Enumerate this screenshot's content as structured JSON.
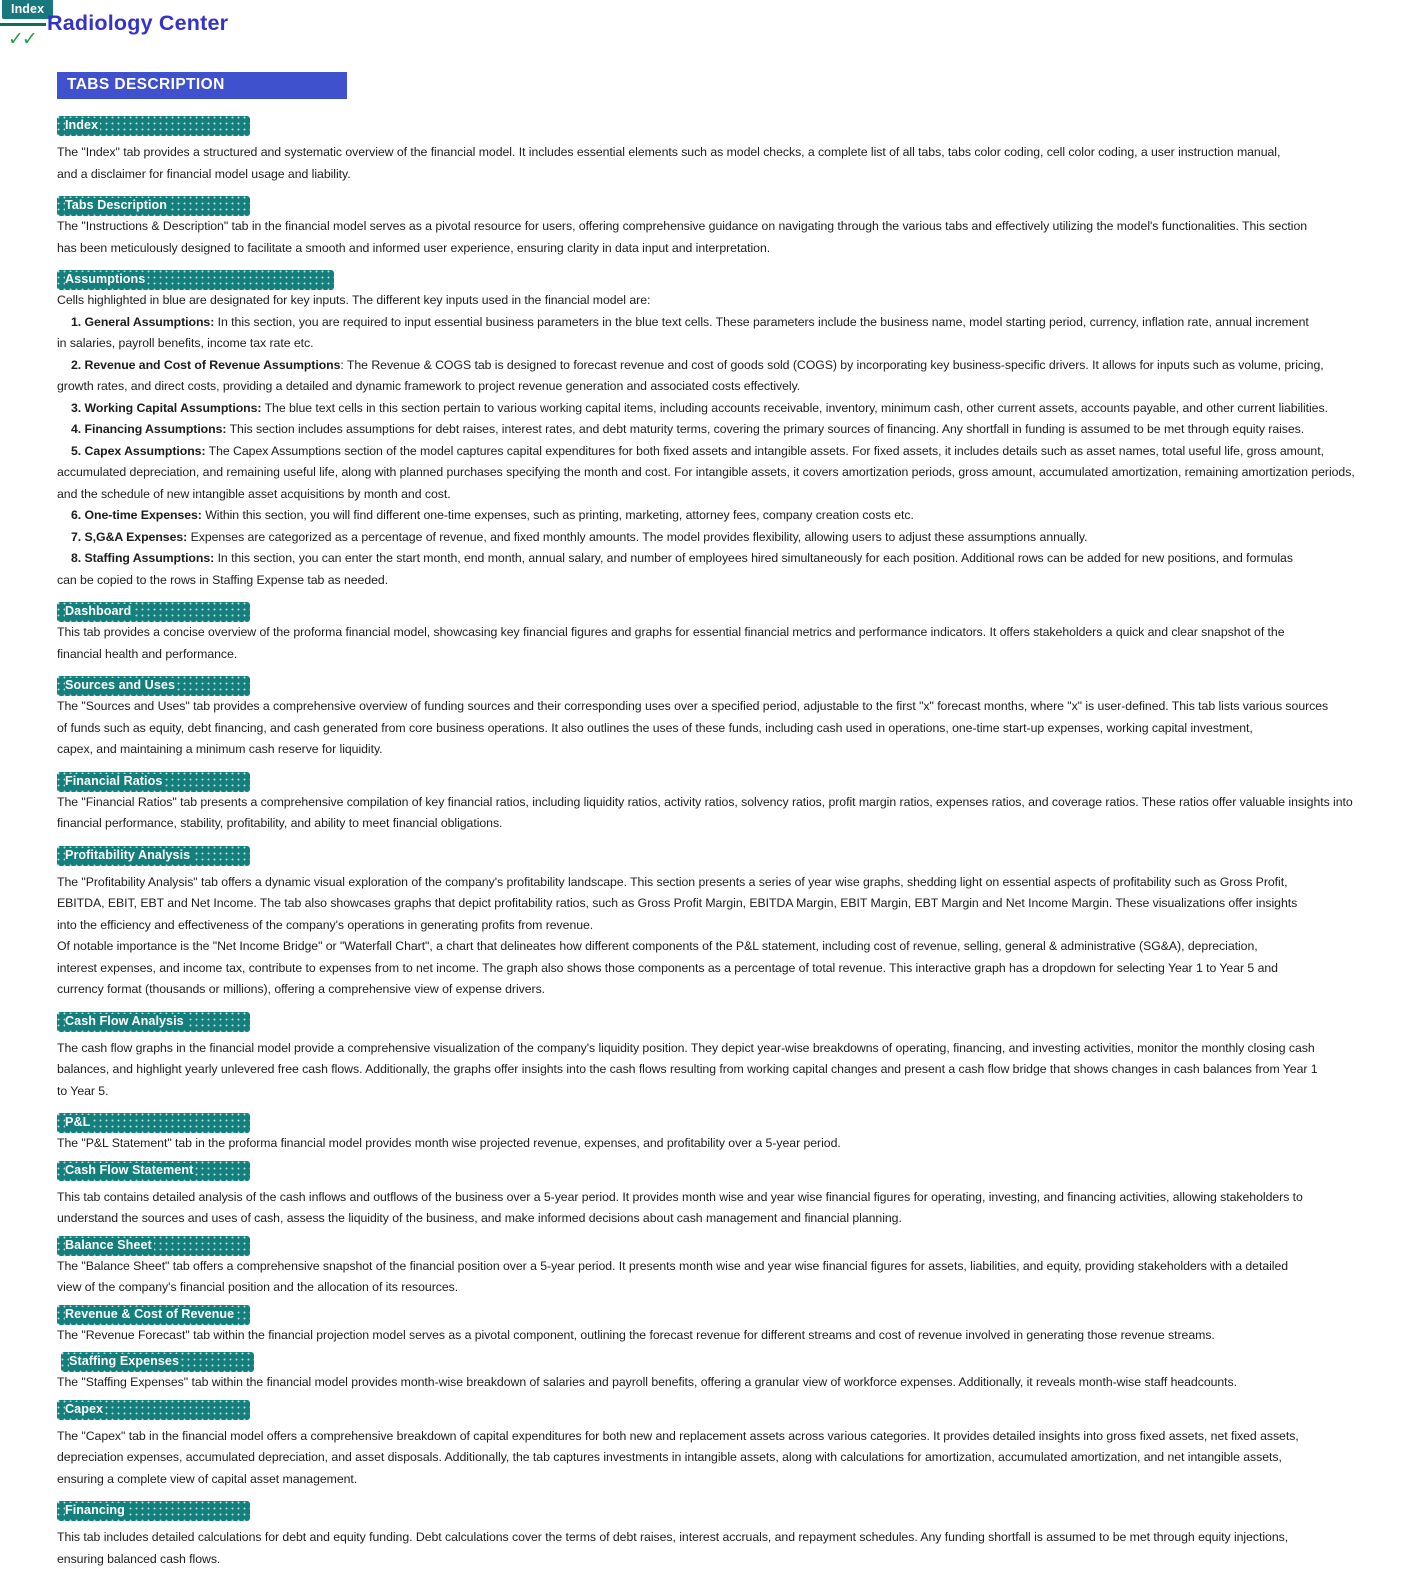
{
  "header": {
    "index_tab": "Index",
    "checkmarks": "✓✓",
    "title": "Radiology Center",
    "banner": "TABS DESCRIPTION",
    "accent_teal": "#14807d",
    "accent_blue": "#3f51cd",
    "title_color": "#3333cc",
    "check_color": "#21a04a"
  },
  "sections": {
    "index": {
      "label": "Index",
      "lines": [
        "The \"Index\" tab provides a structured and systematic overview of the financial model. It includes essential elements such as model checks, a complete list of all tabs, tabs color coding, cell color coding, a user instruction manual,",
        "and a disclaimer for financial model usage and liability."
      ]
    },
    "tabs_description": {
      "label": "Tabs Description",
      "lines": [
        "The \"Instructions & Description\" tab in the financial model serves as a pivotal resource for users, offering comprehensive guidance on navigating through the various tabs and effectively utilizing the model's functionalities. This section",
        "has been meticulously designed to facilitate a smooth and informed user experience, ensuring clarity in data input and interpretation."
      ]
    },
    "assumptions": {
      "label": "Assumptions",
      "intro": "Cells highlighted in blue are designated for key inputs. The different key inputs used in the financial model are:",
      "items": [
        {
          "num": "1. ",
          "title": "General Assumptions:",
          "rest": " In this section, you are required to input essential business parameters in the blue text cells. These parameters include the business name, model starting period, currency, inflation rate, annual increment",
          "cont": [
            "in salaries, payroll benefits, income tax rate etc."
          ]
        },
        {
          "num": "2. ",
          "title": "Revenue and Cost of Revenue Assumptions",
          "rest": ": The Revenue & COGS tab is designed to forecast revenue and cost of goods sold (COGS) by incorporating key business-specific drivers. It allows for inputs such as volume, pricing,",
          "cont": [
            "growth rates, and direct costs, providing a detailed and dynamic framework to project revenue generation and associated costs effectively."
          ]
        },
        {
          "num": "3. ",
          "title": "Working Capital Assumptions:",
          "rest": " The blue text cells in this section pertain to various working capital items, including accounts receivable, inventory, minimum cash, other current assets, accounts payable,  and other current liabilities.",
          "cont": []
        },
        {
          "num": "4. ",
          "title": "Financing Assumptions:",
          "rest": " This section includes assumptions for debt raises, interest rates, and debt maturity terms, covering the primary sources of financing. Any shortfall in funding is assumed to be met through equity raises.",
          "cont": []
        },
        {
          "num": "5. ",
          "title": "Capex Assumptions:",
          "rest": " The Capex Assumptions section of the model captures capital expenditures for both fixed assets and intangible assets. For fixed assets, it includes details such as asset names, total useful life, gross amount,",
          "cont": [
            "accumulated depreciation, and remaining useful life, along with planned purchases specifying the month and cost. For intangible assets, it covers amortization periods, gross amount, accumulated amortization, remaining amortization periods,",
            "and the schedule of new intangible asset acquisitions by month and cost."
          ]
        },
        {
          "num": "6. ",
          "title": "One-time Expenses:",
          "rest": " Within this section, you will find different one-time expenses, such as printing, marketing, attorney fees, company creation costs etc.",
          "cont": []
        },
        {
          "num": "7. ",
          "title": "S,G&A Expenses:",
          "rest": "  Expenses are categorized as a percentage  of revenue, and fixed monthly amounts. The model provides flexibility, allowing users to adjust these assumptions annually.",
          "cont": []
        },
        {
          "num": "8. ",
          "title": "Staffing Assumptions:",
          "rest": " In this section, you can enter the start month, end month, annual salary, and number of employees hired simultaneously for each position. Additional rows can be added for new positions, and formulas",
          "cont": [
            "can be copied to the rows in Staffing Expense tab as needed."
          ]
        }
      ]
    },
    "dashboard": {
      "label": "Dashboard",
      "lines": [
        "This tab provides a concise overview of the proforma financial model, showcasing key financial figures and graphs for essential financial metrics and performance indicators. It offers stakeholders a quick and clear snapshot of the",
        "financial health and performance."
      ]
    },
    "sources_and_uses": {
      "label": "Sources and Uses",
      "lines": [
        "The \"Sources and Uses\" tab provides a comprehensive overview of funding sources and their corresponding uses over a specified period, adjustable to the first \"x\" forecast months, where \"x\" is user-defined. This tab lists various sources",
        "of funds such as equity, debt financing, and cash generated from core business operations. It also outlines the uses of these funds, including cash used in operations, one-time start-up expenses, working capital investment,",
        "capex, and maintaining  a minimum cash reserve for liquidity."
      ]
    },
    "financial_ratios": {
      "label": "Financial Ratios",
      "lines": [
        "The \"Financial Ratios\" tab presents a comprehensive compilation of key financial ratios, including liquidity ratios, activity ratios, solvency ratios, profit margin ratios, expenses ratios, and coverage ratios. These ratios offer valuable insights into",
        "financial performance, stability, profitability, and ability to meet financial obligations."
      ]
    },
    "profitability_analysis": {
      "label": "Profitability Analysis",
      "lines": [
        "The \"Profitability Analysis\" tab offers a dynamic visual exploration of the company's profitability landscape. This section presents a series of year wise graphs, shedding light on essential aspects of profitability such as Gross Profit,",
        "EBITDA, EBIT, EBT and Net Income. The tab also showcases graphs that depict profitability ratios, such as Gross Profit Margin, EBITDA Margin, EBIT Margin, EBT Margin and Net Income Margin. These visualizations offer insights",
        "into the efficiency and effectiveness of the company's operations in generating profits from revenue.",
        "Of notable importance is the \"Net Income Bridge\" or \"Waterfall Chart\", a chart that delineates how different components of the P&L statement, including cost of revenue, selling, general & administrative (SG&A), depreciation,",
        "interest expenses, and income tax, contribute to expenses from to net income. The graph also shows those components as a percentage of total revenue. This interactive graph has a dropdown for selecting Year 1 to Year 5 and",
        "currency format (thousands or millions), offering a comprehensive view of expense drivers."
      ]
    },
    "cash_flow_analysis": {
      "label": "Cash Flow Analysis",
      "lines": [
        "The cash flow graphs in the financial model provide a comprehensive visualization of the company's liquidity position. They depict year-wise breakdowns of operating, financing, and investing activities, monitor the monthly closing cash",
        "balances, and highlight yearly unlevered free cash flows. Additionally, the graphs offer insights into the cash flows resulting from working capital changes and present a cash flow bridge that shows changes in cash balances from Year 1",
        "to Year 5."
      ]
    },
    "pl": {
      "label": "P&L",
      "lines": [
        "The \"P&L Statement\" tab in the proforma financial model provides month wise projected revenue, expenses, and profitability over a 5-year period."
      ]
    },
    "cash_flow_statement": {
      "label": "Cash Flow Statement",
      "lines": [
        "This tab contains detailed analysis of the cash inflows and outflows of the business over a 5-year period. It provides month wise and year wise financial figures for operating, investing, and financing activities, allowing stakeholders to",
        "understand the sources and uses of cash, assess the liquidity of the business, and make informed decisions about cash management and financial planning."
      ]
    },
    "balance_sheet": {
      "label": "Balance Sheet",
      "lines": [
        "The \"Balance Sheet\" tab offers a comprehensive snapshot of the financial position over a 5-year period. It presents month wise and year wise financial figures for assets, liabilities, and equity, providing stakeholders with a detailed",
        "view of the company's financial position and the allocation of its resources."
      ]
    },
    "revenue_cost_of_revenue": {
      "label": "Revenue & Cost of Revenue",
      "lines": [
        "The \"Revenue Forecast\" tab within the financial projection model serves as a pivotal component, outlining the forecast revenue for different streams and cost of revenue involved in generating those revenue streams."
      ]
    },
    "staffing_expenses": {
      "label": "Staffing Expenses",
      "lines": [
        "The \"Staffing Expenses\" tab within the financial model provides month-wise breakdown of salaries and payroll benefits, offering  a granular view of workforce expenses. Additionally, it reveals month-wise staff headcounts."
      ]
    },
    "capex": {
      "label": "Capex",
      "lines": [
        "The \"Capex\" tab in the financial model offers a comprehensive breakdown of capital expenditures for both new and replacement assets across various categories. It provides detailed insights into gross fixed assets, net fixed assets,",
        "depreciation expenses, accumulated depreciation, and asset disposals. Additionally, the tab captures investments in intangible assets, along with calculations for amortization, accumulated amortization, and net intangible assets,",
        "ensuring a complete view of capital asset management."
      ]
    },
    "financing": {
      "label": "Financing",
      "lines": [
        "This tab includes detailed calculations for debt and equity funding. Debt calculations cover the terms of debt raises, interest accruals, and repayment schedules. Any funding shortfall is assumed to be met through equity injections,",
        "ensuring balanced cash flows."
      ]
    }
  }
}
